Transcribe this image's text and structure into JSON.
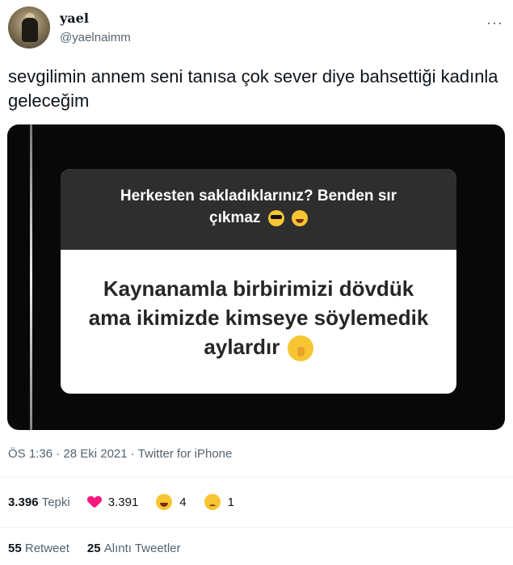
{
  "user": {
    "display_name": "yael",
    "handle": "@yaelnaimm"
  },
  "more_menu": "···",
  "tweet": {
    "text": "sevgilimin annem seni tanısa çok sever diye bahsettiği kadınla geleceğim"
  },
  "media": {
    "question": "Herkesten sakladıklarınız? Benden sır çıkmaz",
    "answer": "Kaynanamla birbirimizi dövdük ama ikimizde kimseye söylemedik aylardır",
    "question_emojis": [
      "sunglasses-emoji",
      "laughing-emoji"
    ],
    "answer_emoji": "shushing-emoji"
  },
  "meta": {
    "timestamp": "ÖS 1:36 · 28 Eki 2021 · Twitter for iPhone"
  },
  "stats": {
    "reactions_count": "3.396",
    "reactions_label": "Tepki",
    "heart_count": "3.391",
    "laugh_count": "4",
    "sad_count": "1",
    "retweets_count": "55",
    "retweets_label": "Retweet",
    "quotes_count": "25",
    "quotes_label": "Alıntı Tweetler"
  },
  "colors": {
    "text": "#0f1419",
    "secondary": "#536471",
    "heart": "#f91880"
  }
}
